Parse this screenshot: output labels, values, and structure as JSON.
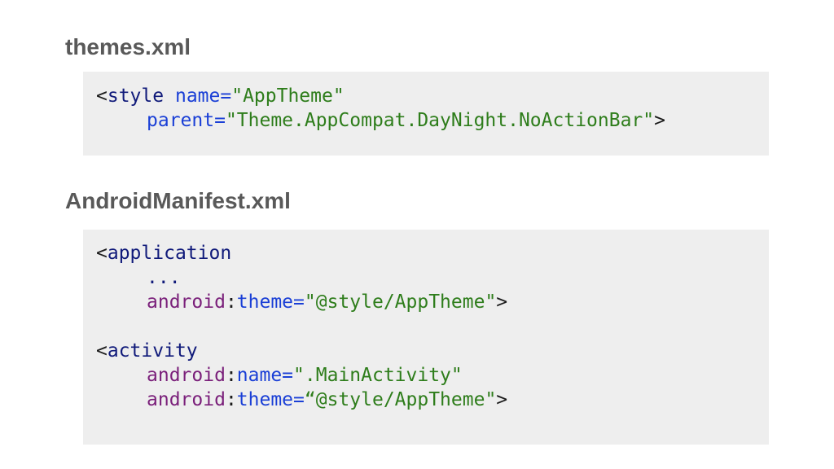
{
  "sections": [
    {
      "title": "themes.xml",
      "code": {
        "lines": [
          {
            "open": "<",
            "tag": "style",
            "sp": " ",
            "attr": "name=",
            "val": "\"AppTheme\""
          },
          {
            "attr": "parent=",
            "val": "\"Theme.AppCompat.DayNight.NoActionBar\"",
            "close": ">"
          }
        ]
      }
    },
    {
      "title": "AndroidManifest.xml",
      "code": {
        "lines": [
          {
            "open": "<",
            "tag": "application"
          },
          {
            "ellipsis": "..."
          },
          {
            "ns": "android",
            "colon": ":",
            "attr": "theme=",
            "val": "\"@style/AppTheme\"",
            "close": ">"
          },
          {
            "blank": ""
          },
          {
            "open": "<",
            "tag": "activity"
          },
          {
            "ns": "android",
            "colon": ":",
            "attr": "name=",
            "val": "\".MainActivity\""
          },
          {
            "ns": "android",
            "colon": ":",
            "attr": "theme=",
            "val": "“@style/AppTheme\"",
            "close": ">"
          }
        ]
      }
    }
  ],
  "colors": {
    "heading": "#595959",
    "code_background": "#eeeeee",
    "tag": "#101a7a",
    "attribute": "#1a3fd6",
    "value": "#2e7d1b",
    "namespace": "#7a1f7a"
  }
}
